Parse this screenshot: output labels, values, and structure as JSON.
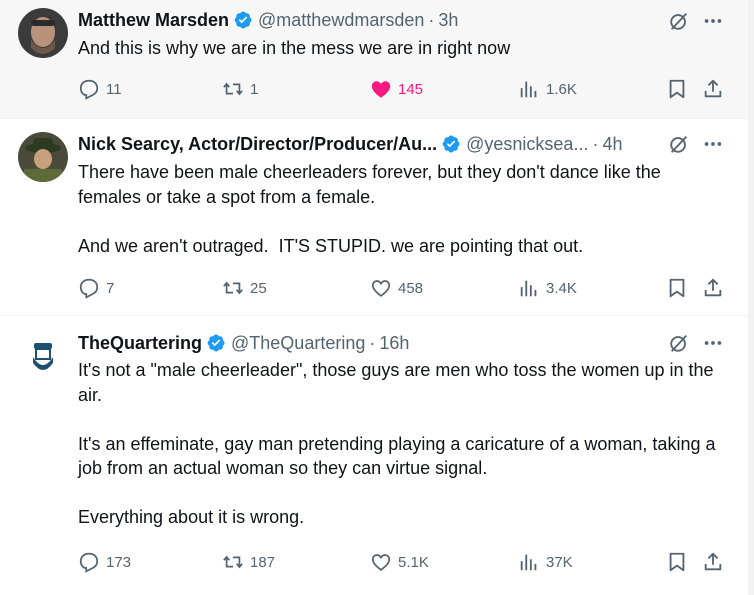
{
  "tweets": [
    {
      "name": "Matthew Marsden",
      "handle": "@matthewdmarsden",
      "time": "3h",
      "text": "And this is why we are in the mess we are in right now",
      "replies": "11",
      "retweets": "1",
      "likes": "145",
      "views": "1.6K",
      "liked": true
    },
    {
      "name": "Nick Searcy, Actor/Director/Producer/Au...",
      "handle": "@yesnicksea...",
      "time": "4h",
      "text": "There have been male cheerleaders forever, but they don't dance like the females or take a spot from a female.\n\nAnd we aren't outraged.  IT'S STUPID. we are pointing that out.",
      "replies": "7",
      "retweets": "25",
      "likes": "458",
      "views": "3.4K",
      "liked": false
    },
    {
      "name": "TheQuartering",
      "handle": "@TheQuartering",
      "time": "16h",
      "text": "It's not a \"male cheerleader\", those guys are men who toss the women up in the air.\n\nIt's an effeminate, gay man pretending playing a caricature of a woman, taking a job from an actual woman so they can virtue signal.\n\nEverything about it is wrong.",
      "replies": "173",
      "retweets": "187",
      "likes": "5.1K",
      "views": "37K",
      "liked": false
    }
  ],
  "colors": {
    "verified": "#1d9bf0",
    "muted": "#536471",
    "like_active": "#f91880",
    "text": "#0f1419"
  },
  "icons": [
    "verified-badge-icon",
    "grok-icon",
    "more-icon",
    "reply-icon",
    "retweet-icon",
    "like-icon",
    "views-icon",
    "bookmark-icon",
    "share-icon"
  ],
  "separator": "·"
}
